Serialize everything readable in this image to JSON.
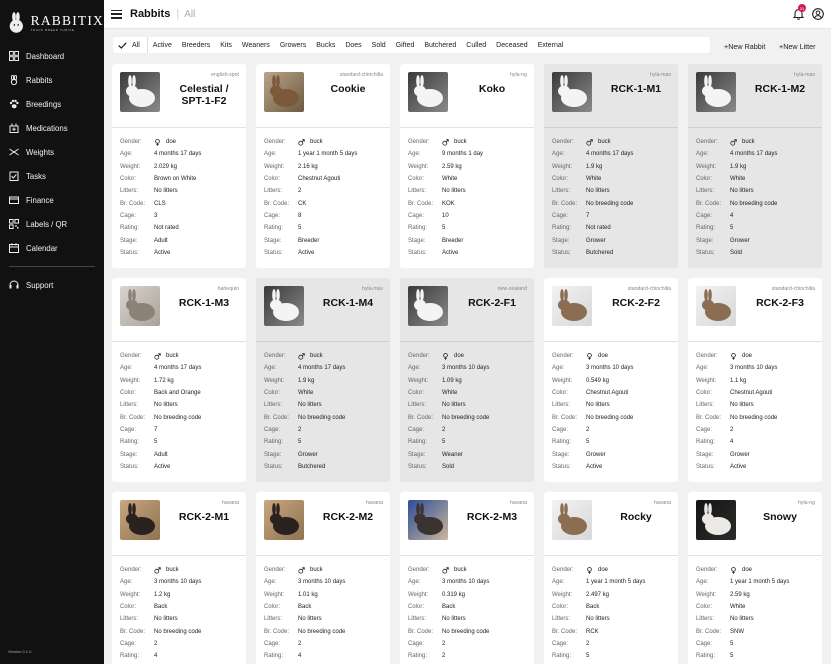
{
  "app": {
    "logo_text": "RABBITIX",
    "logo_sub": "TRACK BREED THRIVE",
    "version": "Version 0.1.0"
  },
  "sidebar": {
    "items": [
      {
        "label": "Dashboard",
        "icon": "dashboard-icon"
      },
      {
        "label": "Rabbits",
        "icon": "rabbit-icon"
      },
      {
        "label": "Breedings",
        "icon": "paw-icon"
      },
      {
        "label": "Medications",
        "icon": "medication-icon"
      },
      {
        "label": "Weights",
        "icon": "scale-icon"
      },
      {
        "label": "Tasks",
        "icon": "tasks-icon"
      },
      {
        "label": "Finance",
        "icon": "finance-icon"
      },
      {
        "label": "Labels / QR",
        "icon": "qr-icon"
      },
      {
        "label": "Calendar",
        "icon": "calendar-icon"
      }
    ],
    "support": {
      "label": "Support",
      "icon": "support-icon"
    }
  },
  "header": {
    "title": "Rabbits",
    "current_filter": "All",
    "notification_count": "31"
  },
  "filters": {
    "tabs": [
      "All",
      "Active",
      "Breeders",
      "Kits",
      "Weaners",
      "Growers",
      "Bucks",
      "Does",
      "Sold",
      "Gifted",
      "Butchered",
      "Culled",
      "Deceased",
      "External"
    ],
    "active": "All",
    "add_rabbit": "+New Rabbit",
    "add_litter": "+New Litter"
  },
  "labels": {
    "gender": "Gender:",
    "age": "Age:",
    "weight": "Weight:",
    "color": "Color:",
    "litters": "Litters:",
    "br_code": "Br. Code:",
    "cage": "Cage:",
    "rating": "Rating:",
    "stage": "Stage:",
    "status": "Status:"
  },
  "rabbits": [
    {
      "breed": "english-spot",
      "name": "Celestial / SPT-1-F2",
      "gender": "doe",
      "age": "4 months 17 days",
      "weight": "2.029 kg",
      "color": "Brown on White",
      "litters": "No litters",
      "br_code": "CLS",
      "cage": "3",
      "rating": "Not rated",
      "stage": "Adult",
      "status": "Active",
      "muted": false,
      "photo": "white"
    },
    {
      "breed": "standard-chinchilla",
      "name": "Cookie",
      "gender": "buck",
      "age": "1 year 1 month 5 days",
      "weight": "2.16 kg",
      "color": "Chestnut Agouti",
      "litters": "2",
      "br_code": "CK",
      "cage": "8",
      "rating": "5",
      "stage": "Breeder",
      "status": "Active",
      "muted": false,
      "photo": "brown"
    },
    {
      "breed": "hyla-ng",
      "name": "Koko",
      "gender": "buck",
      "age": "9 months 1 day",
      "weight": "2.59 kg",
      "color": "White",
      "litters": "No litters",
      "br_code": "KOK",
      "cage": "10",
      "rating": "5",
      "stage": "Breeder",
      "status": "Active",
      "muted": false,
      "photo": "white"
    },
    {
      "breed": "hyla-max",
      "name": "RCK-1-M1",
      "gender": "buck",
      "age": "4 months 17 days",
      "weight": "1.9 kg",
      "color": "White",
      "litters": "No litters",
      "br_code": "No breeding code",
      "cage": "7",
      "rating": "Not rated",
      "stage": "Grower",
      "status": "Butchered",
      "muted": true,
      "photo": "white"
    },
    {
      "breed": "hyla-max",
      "name": "RCK-1-M2",
      "gender": "buck",
      "age": "4 months 17 days",
      "weight": "1.9 kg",
      "color": "White",
      "litters": "No litters",
      "br_code": "No breeding code",
      "cage": "4",
      "rating": "5",
      "stage": "Grower",
      "status": "Sold",
      "muted": true,
      "photo": "white"
    },
    {
      "breed": "harlequin",
      "name": "RCK-1-M3",
      "gender": "buck",
      "age": "4 months 17 days",
      "weight": "1.72 kg",
      "color": "Back and Orange",
      "litters": "No litters",
      "br_code": "No breeding code",
      "cage": "7",
      "rating": "5",
      "stage": "Adult",
      "status": "Active",
      "muted": false,
      "photo": "grey"
    },
    {
      "breed": "hyla-max",
      "name": "RCK-1-M4",
      "gender": "buck",
      "age": "4 months 17 days",
      "weight": "1.9 kg",
      "color": "White",
      "litters": "No litters",
      "br_code": "No breeding code",
      "cage": "2",
      "rating": "5",
      "stage": "Grower",
      "status": "Butchered",
      "muted": true,
      "photo": "white"
    },
    {
      "breed": "new-zealand",
      "name": "RCK-2-F1",
      "gender": "doe",
      "age": "3 months 10 days",
      "weight": "1.09 kg",
      "color": "White",
      "litters": "No litters",
      "br_code": "No breeding code",
      "cage": "2",
      "rating": "5",
      "stage": "Weaner",
      "status": "Sold",
      "muted": true,
      "photo": "white"
    },
    {
      "breed": "standard-chinchilla",
      "name": "RCK-2-F2",
      "gender": "doe",
      "age": "3 months 10 days",
      "weight": "0.549 kg",
      "color": "Chestnut Agouti",
      "litters": "No litters",
      "br_code": "No breeding code",
      "cage": "2",
      "rating": "5",
      "stage": "Grower",
      "status": "Active",
      "muted": false,
      "photo": "agouti"
    },
    {
      "breed": "standard-chinchilla",
      "name": "RCK-2-F3",
      "gender": "doe",
      "age": "3 months 10 days",
      "weight": "1.1 kg",
      "color": "Chestnut Agouti",
      "litters": "No litters",
      "br_code": "No breeding code",
      "cage": "2",
      "rating": "4",
      "stage": "Grower",
      "status": "Active",
      "muted": false,
      "photo": "agouti"
    },
    {
      "breed": "havana",
      "name": "RCK-2-M1",
      "gender": "buck",
      "age": "3 months 10 days",
      "weight": "1.2 kg",
      "color": "Back",
      "litters": "No litters",
      "br_code": "No breeding code",
      "cage": "2",
      "rating": "4",
      "stage": "",
      "status": "",
      "muted": false,
      "photo": "dark"
    },
    {
      "breed": "havana",
      "name": "RCK-2-M2",
      "gender": "buck",
      "age": "3 months 10 days",
      "weight": "1.01 kg",
      "color": "Back",
      "litters": "No litters",
      "br_code": "No breeding code",
      "cage": "2",
      "rating": "4",
      "stage": "",
      "status": "",
      "muted": false,
      "photo": "dark"
    },
    {
      "breed": "havana",
      "name": "RCK-2-M3",
      "gender": "buck",
      "age": "3 months 10 days",
      "weight": "0.319 kg",
      "color": "Back",
      "litters": "No litters",
      "br_code": "No breeding code",
      "cage": "2",
      "rating": "2",
      "stage": "",
      "status": "",
      "muted": false,
      "photo": "blue"
    },
    {
      "breed": "havana",
      "name": "Rocky",
      "gender": "doe",
      "age": "1 year 1 month 5 days",
      "weight": "2.497 kg",
      "color": "Back",
      "litters": "No litters",
      "br_code": "RCK",
      "cage": "2",
      "rating": "5",
      "stage": "",
      "status": "",
      "muted": false,
      "photo": "agouti"
    },
    {
      "breed": "hyla-ng",
      "name": "Snowy",
      "gender": "doe",
      "age": "1 year 1 month 5 days",
      "weight": "2.59 kg",
      "color": "White",
      "litters": "No litters",
      "br_code": "SNW",
      "cage": "5",
      "rating": "5",
      "stage": "",
      "status": "",
      "muted": false,
      "photo": "night"
    }
  ],
  "colors": {
    "sidebar_bg": "#111111",
    "page_bg": "#f1f1f1",
    "card_bg": "#ffffff",
    "card_muted_bg": "#e6e6e6",
    "badge": "#d21d52"
  }
}
